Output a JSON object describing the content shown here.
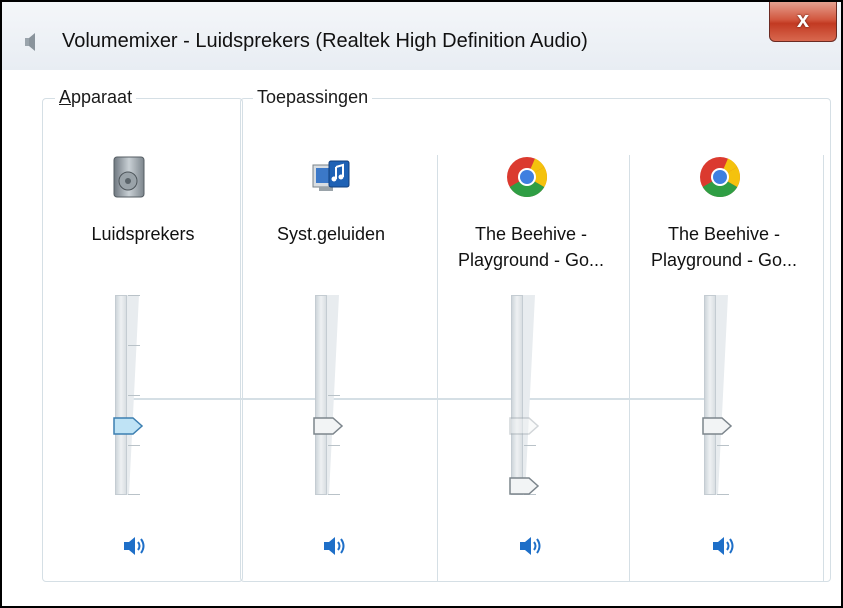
{
  "window": {
    "title": "Volumemixer - Luidsprekers (Realtek High Definition Audio)",
    "close_label": "x"
  },
  "device_group": {
    "label_underlined": "A",
    "label_rest": "pparaat",
    "device": {
      "name": "Luidsprekers",
      "icon": "speaker-device-icon",
      "volume": 0.35,
      "muted": false
    }
  },
  "apps_group": {
    "label": "Toepassingen",
    "apps": [
      {
        "name_line1": "Syst.geluiden",
        "name_line2": "",
        "icon": "system-sounds-icon",
        "volume": 0.35
      },
      {
        "name_line1": "The Beehive -",
        "name_line2": "Playground - Go...",
        "icon": "chrome-icon",
        "volume": 0.02,
        "ghost_volume": 0.35
      },
      {
        "name_line1": "The Beehive -",
        "name_line2": "Playground - Go...",
        "icon": "chrome-icon",
        "volume": 0.35
      }
    ]
  },
  "colors": {
    "accent_thumb": "#bfe3f5",
    "speaker_blue": "#1e6fc8",
    "group_border": "#d5dfe5"
  }
}
